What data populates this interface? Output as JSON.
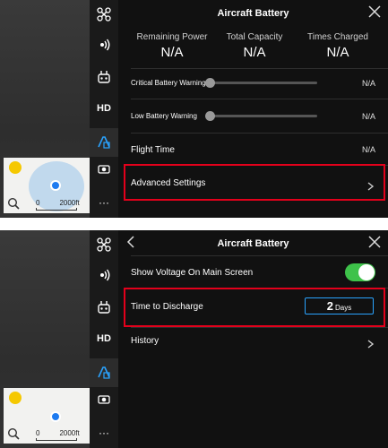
{
  "screen1": {
    "title": "Aircraft Battery",
    "stats": [
      {
        "label": "Remaining Power",
        "value": "N/A"
      },
      {
        "label": "Total Capacity",
        "value": "N/A"
      },
      {
        "label": "Times Charged",
        "value": "N/A"
      }
    ],
    "critical_warning": {
      "label": "Critical Battery Warning",
      "value": "N/A"
    },
    "low_warning": {
      "label": "Low Battery Warning",
      "value": "N/A"
    },
    "flight_time": {
      "label": "Flight Time",
      "value": "N/A"
    },
    "advanced_settings": {
      "label": "Advanced Settings"
    }
  },
  "screen2": {
    "title": "Aircraft Battery",
    "show_voltage": {
      "label": "Show Voltage On Main Screen",
      "enabled": true
    },
    "time_to_discharge": {
      "label": "Time to Discharge",
      "value": "2",
      "unit": "Days"
    },
    "history": {
      "label": "History"
    }
  },
  "rail": {
    "hd_label": "HD"
  },
  "map": {
    "scale_start": "0",
    "scale_end": "2000ft"
  },
  "colors": {
    "accent": "#2aa3ff",
    "highlight": "#e3001b",
    "toggle_on": "#3ec24a"
  }
}
